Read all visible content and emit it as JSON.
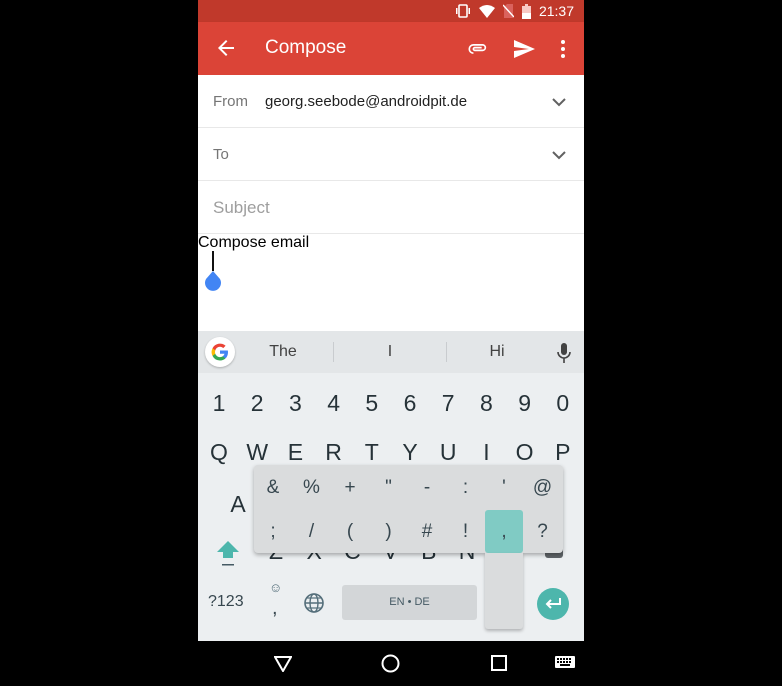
{
  "status_bar": {
    "icons": [
      "vibrate-icon",
      "wifi-icon",
      "no-sim-icon",
      "battery-icon"
    ],
    "time": "21:37"
  },
  "app_bar": {
    "title": "Compose",
    "back_icon": "arrow-back-icon",
    "actions": [
      "attach-icon",
      "send-icon",
      "more-vert-icon"
    ],
    "color": "#db4437"
  },
  "form": {
    "from_label": "From",
    "from_value": "georg.seebode@androidpit.de",
    "to_label": "To",
    "subject_placeholder": "Subject",
    "body_placeholder": "Compose email"
  },
  "keyboard": {
    "suggestions": [
      "The",
      "I",
      "Hi"
    ],
    "number_row": [
      "1",
      "2",
      "3",
      "4",
      "5",
      "6",
      "7",
      "8",
      "9",
      "0"
    ],
    "top_row": [
      "Q",
      "W",
      "E",
      "R",
      "T",
      "Y",
      "U",
      "I",
      "O",
      "P"
    ],
    "home_row_visible": [
      "A"
    ],
    "bottom_row_partial": [
      "Z",
      "X",
      "C",
      "V",
      "B",
      "N"
    ],
    "popup_row1": [
      "&",
      "%",
      "+",
      "\"",
      "-",
      ":",
      "'",
      "@"
    ],
    "popup_row2": [
      ";",
      "/",
      "(",
      ")",
      "#",
      "!",
      ",",
      "?"
    ],
    "popup_selected": ",",
    "symbols_key": "?123",
    "emoji_icon": "☺",
    "comma_key": ",",
    "space_label": "EN • DE",
    "accent_color": "#4db6ac"
  },
  "nav_bar": {
    "buttons": [
      "back-triangle-icon",
      "home-circle-icon",
      "recents-square-icon",
      "keyboard-switch-icon"
    ]
  }
}
